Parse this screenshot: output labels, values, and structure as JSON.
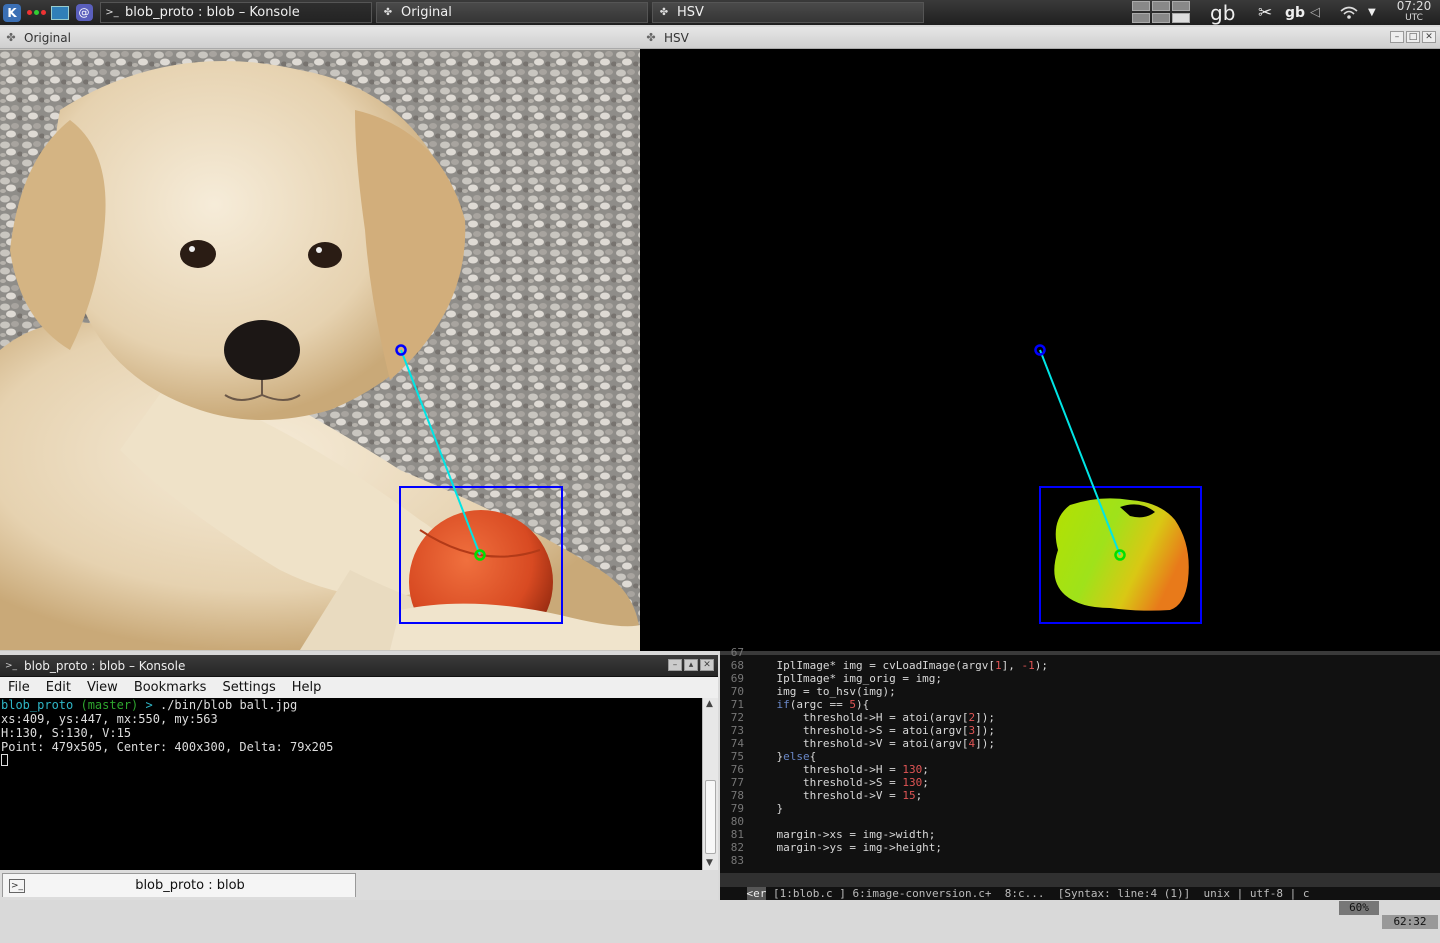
{
  "panel": {
    "tasks": [
      {
        "label": "blob_proto : blob – Konsole",
        "icon": "terminal-icon"
      },
      {
        "label": "Original",
        "icon": "opencv-window-icon"
      },
      {
        "label": "HSV",
        "icon": "opencv-window-icon"
      }
    ],
    "keyboard_layout": "gb",
    "keyboard_layout_small": "gb",
    "clock": {
      "time": "07:20",
      "tz": "UTC"
    }
  },
  "windows": {
    "original": {
      "title": "Original"
    },
    "hsv": {
      "title": "HSV"
    }
  },
  "konsole": {
    "title": "blob_proto : blob – Konsole",
    "menu": [
      "File",
      "Edit",
      "View",
      "Bookmarks",
      "Settings",
      "Help"
    ],
    "prompt_dir": "blob_proto",
    "prompt_branch": "(master)",
    "prompt_sym": ">",
    "command": "./bin/blob ball.jpg",
    "output": [
      "xs:409, ys:447, mx:550, my:563",
      "H:130, S:130, V:15",
      "Point: 479x505, Center: 400x300, Delta: 79x205"
    ],
    "tab_label": "blob_proto : blob"
  },
  "vim": {
    "lines": [
      {
        "n": "67",
        "text": ""
      },
      {
        "n": "68",
        "text": "    IplImage* img = cvLoadImage(argv[1], -1);"
      },
      {
        "n": "69",
        "text": "    IplImage* img_orig = img;"
      },
      {
        "n": "70",
        "text": "    img = to_hsv(img);"
      },
      {
        "n": "71",
        "text": "    if(argc == 5){"
      },
      {
        "n": "72",
        "text": "        threshold->H = atoi(argv[2]);"
      },
      {
        "n": "73",
        "text": "        threshold->S = atoi(argv[3]);"
      },
      {
        "n": "74",
        "text": "        threshold->V = atoi(argv[4]);"
      },
      {
        "n": "75",
        "text": "    }else{"
      },
      {
        "n": "76",
        "text": "        threshold->H = 130;"
      },
      {
        "n": "77",
        "text": "        threshold->S = 130;"
      },
      {
        "n": "78",
        "text": "        threshold->V = 15;"
      },
      {
        "n": "79",
        "text": "    }"
      },
      {
        "n": "80",
        "text": ""
      },
      {
        "n": "81",
        "text": "    margin->xs = img->width;"
      },
      {
        "n": "82",
        "text": "    margin->ys = img->height;"
      },
      {
        "n": "83",
        "text": ""
      }
    ],
    "status": {
      "mode": "<er",
      "buffers": " [1:blob.c ] 6:image-conversion.c+  8:c...  ",
      "syntax": "[Syntax: line:4 (1)]  unix | utf-8 | c ",
      "percent": "60%",
      "position": "62:32"
    }
  },
  "overlay": {
    "center_color": "#0000ff",
    "line_color": "#00e5e5",
    "point_color": "#00e000",
    "box_color": "#0000ff"
  }
}
